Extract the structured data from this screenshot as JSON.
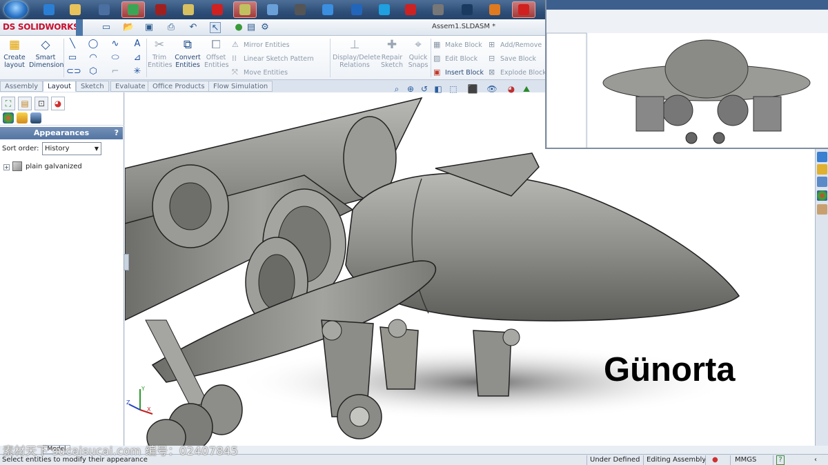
{
  "taskbar": {
    "buttons": [
      {
        "icon": "internet-explorer-icon",
        "color": "#2a7fd4"
      },
      {
        "icon": "folder-icon",
        "color": "#e8c25a"
      },
      {
        "icon": "network-icon",
        "color": "#4a6fa0"
      },
      {
        "icon": "chrome-icon",
        "color": "#3aa655"
      },
      {
        "icon": "game-icon",
        "color": "#a02020"
      },
      {
        "icon": "media-icon",
        "color": "#d8c060"
      },
      {
        "icon": "solidworks-icon",
        "color": "#d02020"
      },
      {
        "icon": "tool-icon",
        "color": "#c0c060"
      },
      {
        "icon": "notepad-icon",
        "color": "#6aa0d8"
      },
      {
        "icon": "pen-icon",
        "color": "#555555"
      },
      {
        "icon": "itunes-icon",
        "color": "#3a8fe0"
      },
      {
        "icon": "browser-icon",
        "color": "#2266bb"
      },
      {
        "icon": "skype-icon",
        "color": "#1fa0e0"
      },
      {
        "icon": "pdf-icon",
        "color": "#cc2222"
      },
      {
        "icon": "image-icon",
        "color": "#777777"
      },
      {
        "icon": "photo-icon",
        "color": "#1a3a60"
      },
      {
        "icon": "globe-icon",
        "color": "#e07a20"
      },
      {
        "icon": "solidworks-icon",
        "color": "#d02020"
      }
    ]
  },
  "app": {
    "logo": "SOLIDWORKS",
    "logo_prefix": "DS",
    "document_title": "Assem1.SLDASM *"
  },
  "ribbon": {
    "create_layout": "Create\nlayout",
    "smart_dimension": "Smart\nDimension",
    "trim_entities": "Trim\nEntities",
    "convert_entities": "Convert\nEntities",
    "offset_entities": "Offset\nEntities",
    "mirror_entities": "Mirror Entities",
    "linear_sketch_pattern": "Linear Sketch Pattern",
    "move_entities": "Move Entities",
    "display_delete_relations": "Display/Delete\nRelations",
    "repair_sketch": "Repair\nSketch",
    "quick_snaps": "Quick\nSnaps",
    "make_block": "Make Block",
    "edit_block": "Edit Block",
    "insert_block": "Insert Block",
    "add_remove": "Add/Remove",
    "save_block": "Save Block",
    "explode_block": "Explode Block"
  },
  "tabs": [
    "Assembly",
    "Layout",
    "Sketch",
    "Evaluate",
    "Office Products",
    "Flow Simulation"
  ],
  "active_tab": "Layout",
  "panel": {
    "title": "Appearances",
    "help": "?",
    "sort_label": "Sort order:",
    "sort_value": "History",
    "tree_item": "plain galvanized",
    "expand_glyph": "+"
  },
  "viewport": {
    "caption": "Günorta",
    "background": "#ffffff",
    "metal_color": "#8e8e8a",
    "triad": {
      "x": "X",
      "y": "Y",
      "z": "Z"
    }
  },
  "statusbar": {
    "message": "Select entities to modify their appearance",
    "state": "Under Defined",
    "mode": "Editing Assembly",
    "units": "MMGS",
    "help": "?",
    "model_tab": "Model"
  },
  "watermark": "素材天下 sucaisucai.com  编号：02407845"
}
